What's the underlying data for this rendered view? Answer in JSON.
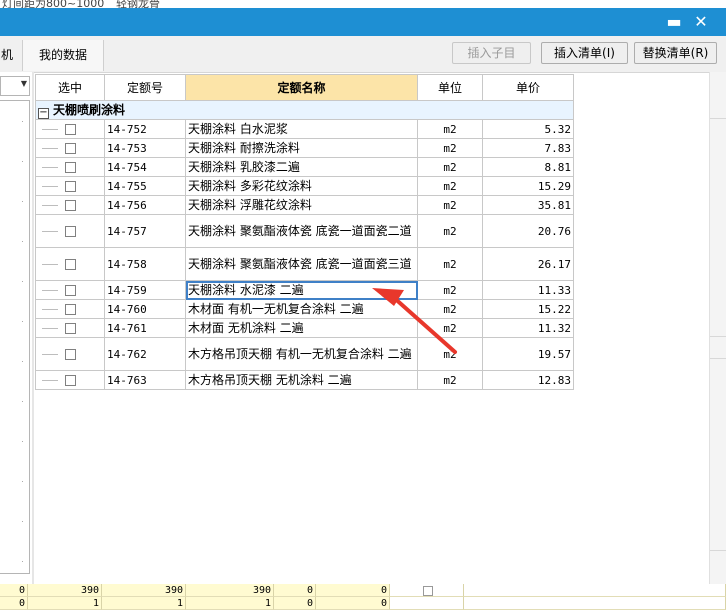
{
  "background_text": [
    "灯间距为800~1000",
    "轻钢龙骨"
  ],
  "window": {
    "minimize_glyph": "▬",
    "close_glyph": "✕"
  },
  "tabs": {
    "left_cut": "机",
    "my_data": "我的数据"
  },
  "buttons": {
    "insert_child": "插入子目",
    "insert_list": "插入清单(I)",
    "replace_list": "替换清单(R)"
  },
  "grid": {
    "headers": [
      "选中",
      "定额号",
      "定额名称",
      "单位",
      "单价"
    ],
    "group_label": "天棚喷刷涂料",
    "group_toggle": "−",
    "rows": [
      {
        "code": "14-752",
        "name": "天棚涂料 白水泥浆",
        "unit": "m2",
        "price": "5.32"
      },
      {
        "code": "14-753",
        "name": "天棚涂料 耐擦洗涂料",
        "unit": "m2",
        "price": "7.83"
      },
      {
        "code": "14-754",
        "name": "天棚涂料 乳胶漆二遍",
        "unit": "m2",
        "price": "8.81"
      },
      {
        "code": "14-755",
        "name": "天棚涂料 多彩花纹涂料",
        "unit": "m2",
        "price": "15.29"
      },
      {
        "code": "14-756",
        "name": "天棚涂料 浮雕花纹涂料",
        "unit": "m2",
        "price": "35.81"
      },
      {
        "code": "14-757",
        "name": "天棚涂料 聚氨酯液体瓷 底瓷一道面瓷二道",
        "unit": "m2",
        "price": "20.76"
      },
      {
        "code": "14-758",
        "name": "天棚涂料 聚氨酯液体瓷 底瓷一道面瓷三道",
        "unit": "m2",
        "price": "26.17"
      },
      {
        "code": "14-759",
        "name": "天棚涂料 水泥漆 二遍",
        "unit": "m2",
        "price": "11.33"
      },
      {
        "code": "14-760",
        "name": "木材面 有机一无机复合涂料 二遍",
        "unit": "m2",
        "price": "15.22"
      },
      {
        "code": "14-761",
        "name": "木材面 无机涂料 二遍",
        "unit": "m2",
        "price": "11.32"
      },
      {
        "code": "14-762",
        "name": "木方格吊顶天棚 有机一无机复合涂料 二遍",
        "unit": "m2",
        "price": "19.57"
      },
      {
        "code": "14-763",
        "name": "木方格吊顶天棚 无机涂料 二遍",
        "unit": "m2",
        "price": "12.83"
      }
    ]
  },
  "bottom_table": {
    "row1": [
      "0",
      "390",
      "390",
      "390",
      "0",
      "0"
    ],
    "row2": [
      "0",
      "1",
      "1",
      "1",
      "0",
      "0"
    ]
  },
  "colors": {
    "titlebar": "#1e8fd3",
    "selected_header": "#fce4a8",
    "group_row": "#e8f4ff",
    "focus_border": "#3f80c7",
    "arrow": "#e8372b"
  }
}
